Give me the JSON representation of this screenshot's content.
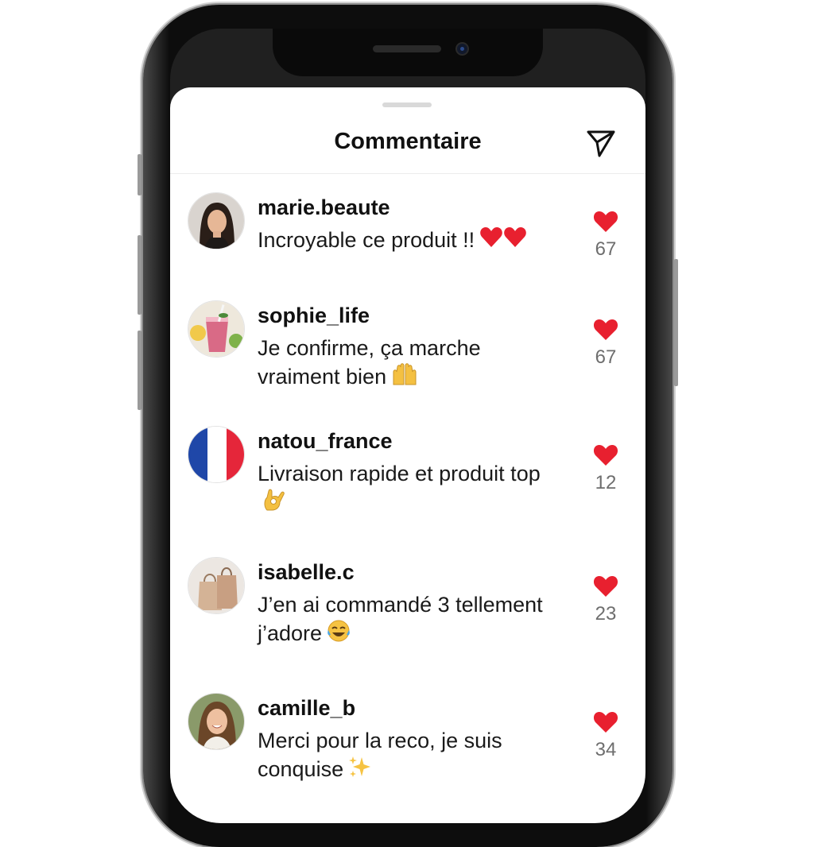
{
  "header": {
    "title": "Commentaire"
  },
  "icons": {
    "send": "send-icon",
    "like": "heart-icon"
  },
  "colors": {
    "like": "#e8202f",
    "text": "#111111",
    "count": "#6e6e6e"
  },
  "comments": [
    {
      "username": "marie.beaute",
      "text": "Incroyable ce produit !!",
      "emoji": "two-red-hearts",
      "likes": "67",
      "avatar": "woman-portrait-avatar"
    },
    {
      "username": "sophie_life",
      "text": "Je confirme, ça marche vraiment bien",
      "emoji": "raising-hands",
      "likes": "67",
      "avatar": "smoothie-avatar"
    },
    {
      "username": "natou_france",
      "text": "Livraison rapide et produit top",
      "emoji": "ok-hand",
      "likes": "12",
      "avatar": "french-flag-avatar"
    },
    {
      "username": "isabelle.c",
      "text": "J’en ai commandé 3 tellement j’adore",
      "emoji": "tears-of-joy",
      "likes": "23",
      "avatar": "shopping-bags-avatar"
    },
    {
      "username": "camille_b",
      "text": "Merci pour la reco, je suis conquise",
      "emoji": "sparkles",
      "likes": "34",
      "avatar": "smiling-woman-avatar"
    }
  ]
}
